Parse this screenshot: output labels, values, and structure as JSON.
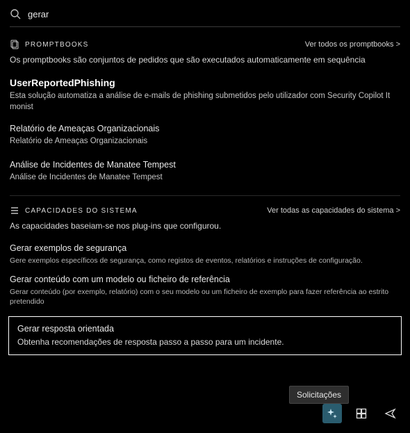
{
  "search": {
    "value": "gerar",
    "placeholder": ""
  },
  "promptbooks": {
    "title": "PROMPTBOOKS",
    "see_all": "Ver todos os promptbooks >",
    "desc": "Os promptbooks são conjuntos de pedidos que são executados automaticamente em sequência",
    "items": [
      {
        "title": "UserReportedPhishing",
        "desc": "Esta solução automatiza a análise de e-mails de phishing submetidos pelo utilizador com Security Copilot It monist",
        "bold": true
      },
      {
        "title": "Relatório de Ameaças Organizacionais",
        "desc": "Relatório de Ameaças Organizacionais"
      },
      {
        "title": "Análise de Incidentes de Manatee Tempest",
        "desc": "Análise de Incidentes de Manatee Tempest"
      }
    ]
  },
  "capabilities": {
    "title": "CAPACIDADES DO SISTEMA",
    "see_all": "Ver todas as capacidades do sistema >",
    "desc": "As capacidades baseiam-se nos plug-ins que configurou.",
    "items": [
      {
        "title": "Gerar exemplos de segurança",
        "desc": "Gere exemplos específicos de segurança, como registos de eventos, relatórios e instruções de configuração."
      },
      {
        "title": "Gerar conteúdo com um modelo ou ficheiro de referência",
        "desc": "Gerar conteúdo (por exemplo, relatório) com o seu modelo ou um ficheiro de exemplo para fazer referência ao estrito pretendido"
      }
    ],
    "selected": {
      "title": "Gerar resposta orientada",
      "desc": "Obtenha recomendações de resposta passo a passo para um incidente."
    }
  },
  "tooltip": "Solicitações"
}
